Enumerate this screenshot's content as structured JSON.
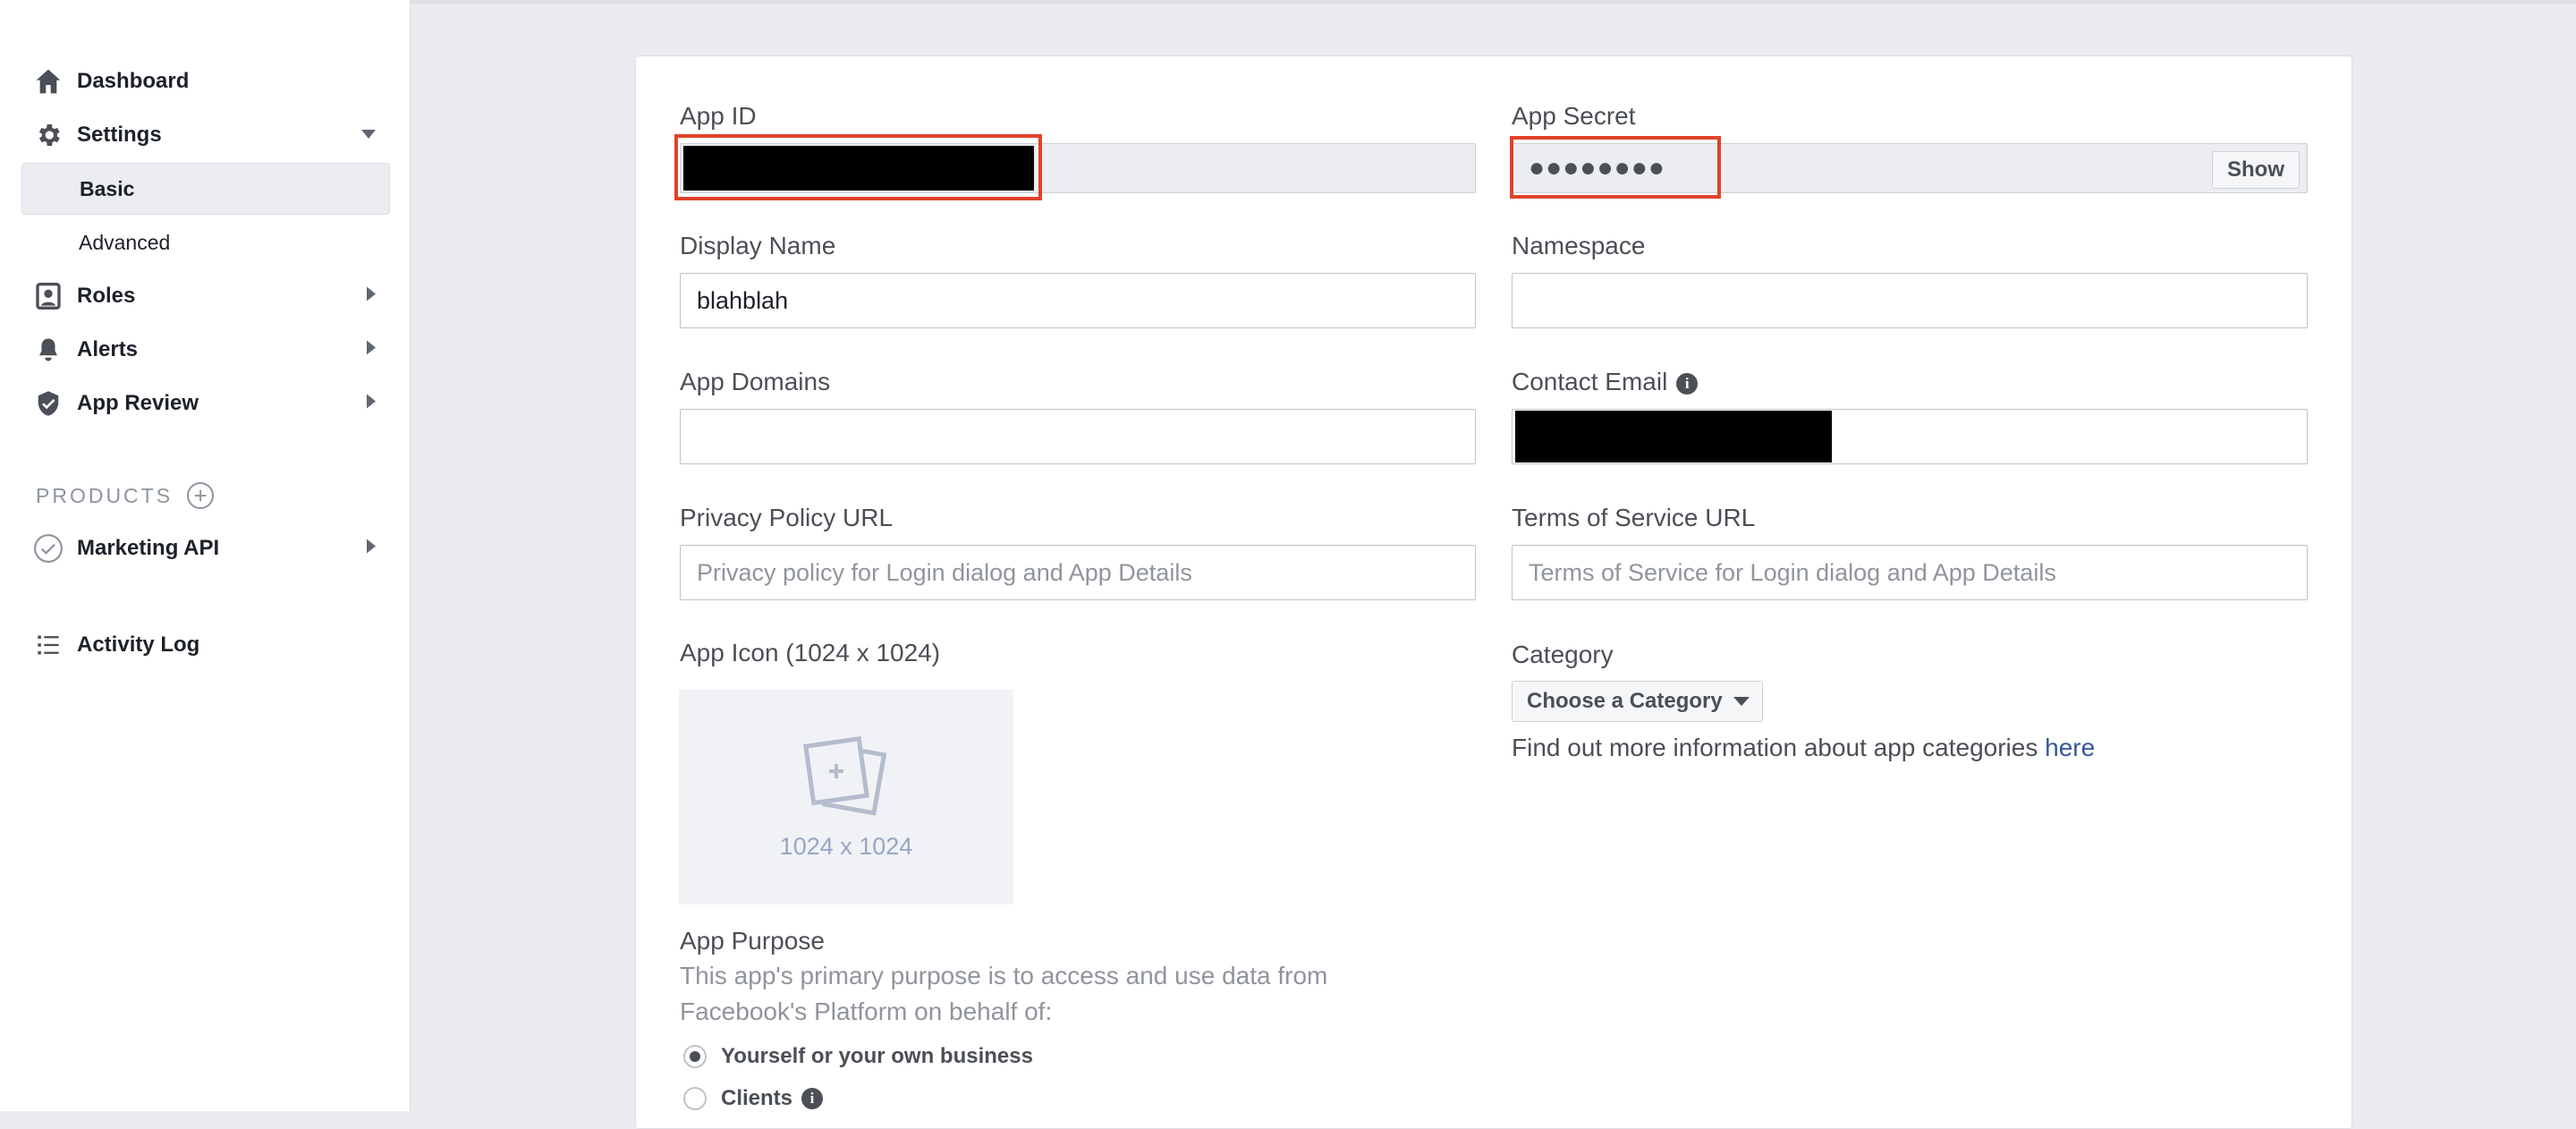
{
  "sidebar": {
    "dashboard": "Dashboard",
    "settings": "Settings",
    "basic": "Basic",
    "advanced": "Advanced",
    "roles": "Roles",
    "alerts": "Alerts",
    "app_review": "App Review",
    "products_header": "PRODUCTS",
    "marketing_api": "Marketing API",
    "activity_log": "Activity Log"
  },
  "form": {
    "app_id_label": "App ID",
    "app_secret_label": "App Secret",
    "app_secret_masked": "●●●●●●●●",
    "show_button": "Show",
    "display_name_label": "Display Name",
    "display_name_value": "blahblah",
    "namespace_label": "Namespace",
    "namespace_value": "",
    "app_domains_label": "App Domains",
    "app_domains_value": "",
    "contact_email_label": "Contact Email",
    "privacy_label": "Privacy Policy URL",
    "privacy_placeholder": "Privacy policy for Login dialog and App Details",
    "tos_label": "Terms of Service URL",
    "tos_placeholder": "Terms of Service for Login dialog and App Details",
    "app_icon_label": "App Icon (1024 x 1024)",
    "app_icon_caption": "1024 x 1024",
    "category_label": "Category",
    "category_button": "Choose a Category",
    "category_help": "Find out more information about app categories ",
    "category_help_link": "here",
    "purpose_label": "App Purpose",
    "purpose_desc_1": "This app's primary purpose is to access and use data from",
    "purpose_desc_2": "Facebook's Platform on behalf of:",
    "purpose_option_1": "Yourself or your own business",
    "purpose_option_2": "Clients"
  },
  "colors": {
    "redaction_outline": "#e2412a",
    "link": "#365899"
  }
}
